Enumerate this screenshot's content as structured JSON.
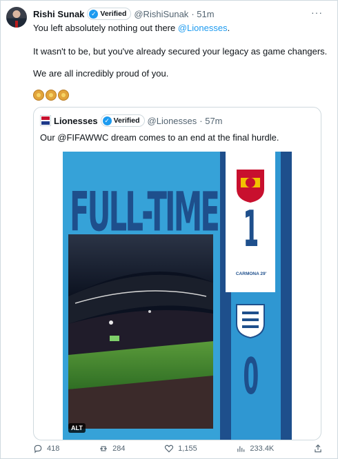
{
  "tweet": {
    "author_name": "Rishi Sunak",
    "verified_label": "Verified",
    "handle": "@RishiSunak",
    "time": "· 51m",
    "more": "···",
    "line1_prefix": "You left absolutely nothing out there ",
    "line1_mention": "@Lionesses",
    "line1_suffix": ".",
    "line2": "It wasn't to be, but you've already secured your legacy as game changers.",
    "line3": "We are all incredibly proud of you."
  },
  "quote": {
    "author_name": "Lionesses",
    "verified_label": "Verified",
    "handle": "@Lionesses",
    "time": "· 57m",
    "text": "Our @FIFAWWC dream comes to an end at the final hurdle.",
    "media": {
      "headline": "FULL-TIME",
      "spain_score": "1",
      "scorer": "CARMONA 29'",
      "england_score": "0",
      "alt_label": "ALT"
    }
  },
  "actions": {
    "replies": "418",
    "reposts": "284",
    "likes": "1,155",
    "views": "233.4K"
  },
  "colors": {
    "accent": "#1d9bf0",
    "media_dark_blue": "#1e4f8c",
    "media_light_blue": "#36a2d8"
  }
}
